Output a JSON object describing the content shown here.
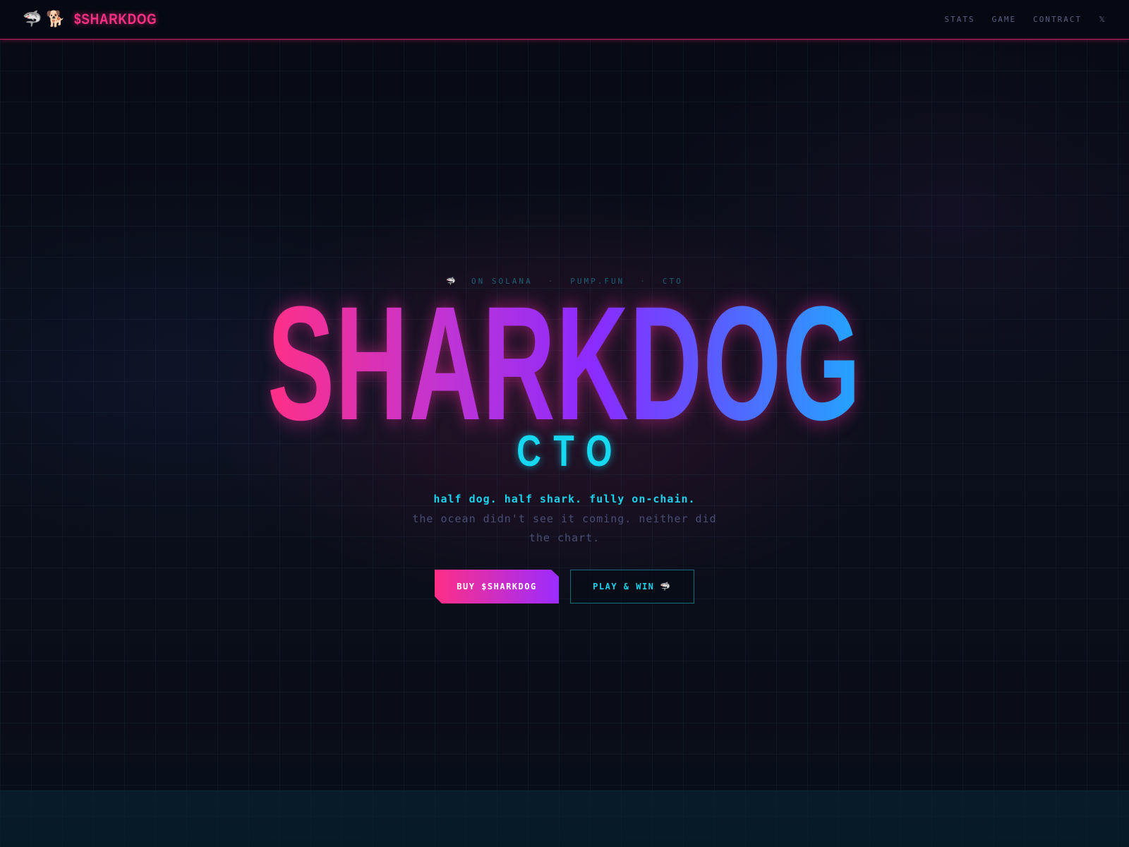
{
  "header": {
    "logo_emoji_1": "🦈",
    "logo_emoji_2": "🐕",
    "brand": "$SHARKDOG",
    "nav": [
      {
        "label": "STATS"
      },
      {
        "label": "GAME"
      },
      {
        "label": "CONTRACT"
      },
      {
        "label": "𝕏"
      }
    ]
  },
  "hero": {
    "chain_icon": "🦈",
    "chain_items": [
      "ON SOLANA",
      "PUMP.FUN",
      "CTO"
    ],
    "separator": "·",
    "title": "SHARKDOG",
    "subtitle": "CTO",
    "tagline": "half dog. half shark. fully on-chain.",
    "description": "the ocean didn't see it coming. neither did the chart.",
    "buy_button": "BUY $SHARKDOG",
    "play_button": "PLAY & WIN",
    "play_icon": "🦈"
  },
  "colors": {
    "accent_pink": "#ff2f86",
    "accent_purple": "#9b2cff",
    "accent_blue": "#22a6ff",
    "accent_cyan": "#16d8f0",
    "background": "#070a14"
  }
}
